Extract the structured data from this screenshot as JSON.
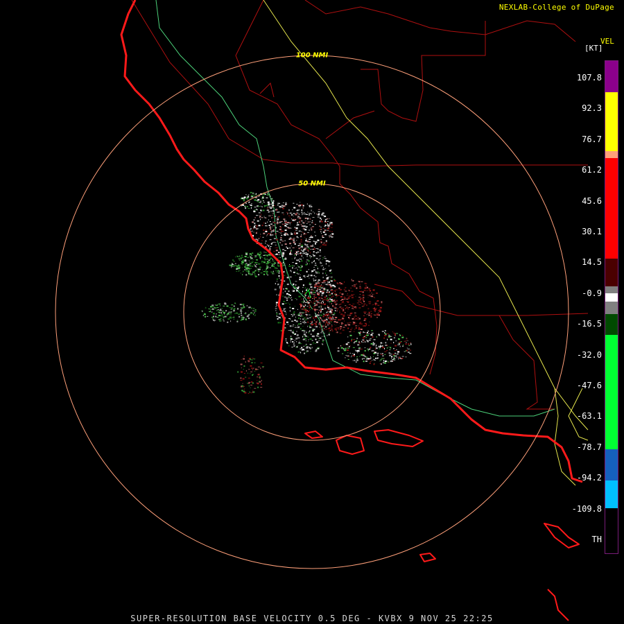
{
  "credit": "NEXLAB-College of DuPage",
  "caption": "SUPER-RESOLUTION BASE VELOCITY 0.5 DEG - KVBX 9 NOV 25 22:25",
  "legend": {
    "product": "VEL",
    "unit": "[KT]",
    "ticks": [
      "107.8",
      "92.3",
      "76.7",
      "61.2",
      "45.6",
      "30.1",
      "14.5",
      "-0.9",
      "-16.5",
      "-32.0",
      "-47.6",
      "-63.1",
      "-78.7",
      "-94.2",
      "-109.8",
      "TH"
    ],
    "colors": {
      "purple": "#8b008b",
      "yellow": "#ffff00",
      "peach": "#ffa07a",
      "red": "#ff0000",
      "darkred": "#4a0000",
      "gray": "#808080",
      "white": "#ffffff",
      "darkgreen": "#004a00",
      "green": "#00ff33",
      "blue": "#1560bd",
      "cyan": "#00bfff",
      "black": "#000000"
    }
  },
  "range_rings": [
    {
      "label": "50 NMI"
    },
    {
      "label": "100 NMI"
    }
  ],
  "map_colors": {
    "coastline": "#ff1a1a",
    "state_county": "#b01010",
    "highway_yellow": "#e6e64d",
    "highway_green": "#4cd27a",
    "ring": "#ffa07a"
  }
}
